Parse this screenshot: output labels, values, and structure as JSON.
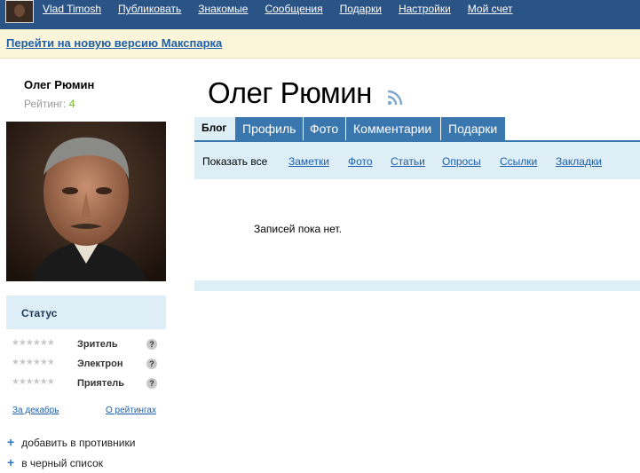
{
  "topbar": {
    "user_name": "Vlad Timosh",
    "nav": [
      "Публиковать",
      "Знакомые",
      "Сообщения",
      "Подарки",
      "Настройки",
      "Мой счет"
    ]
  },
  "notice": {
    "link": "Перейти на новую версию Макспарка"
  },
  "profile": {
    "name": "Олег Рюмин",
    "rating_label": "Рейтинг:",
    "rating_value": "4",
    "status_title": "Статус",
    "statuses": [
      "Зритель",
      "Электрон",
      "Приятель"
    ],
    "stars": "★★★★★★",
    "help": "?",
    "link_december": "За декабрь",
    "link_about_ratings": "О рейтингах",
    "actions": [
      "добавить в противники",
      "в черный список"
    ]
  },
  "main": {
    "title": "Олег Рюмин",
    "tabs": [
      "Блог",
      "Профиль",
      "Фото",
      "Комментарии",
      "Подарки"
    ],
    "subnav": [
      "Показать все",
      "Заметки",
      "Фото",
      "Статьи",
      "Опросы",
      "Ссылки",
      "Закладки"
    ],
    "empty_message": "Записей пока нет."
  },
  "colors": {
    "topbar": "#2a5486",
    "tabs": "#3a77ae",
    "light_blue": "#ddeef7",
    "notice": "#fbf6d9",
    "rating": "#79b52b"
  }
}
